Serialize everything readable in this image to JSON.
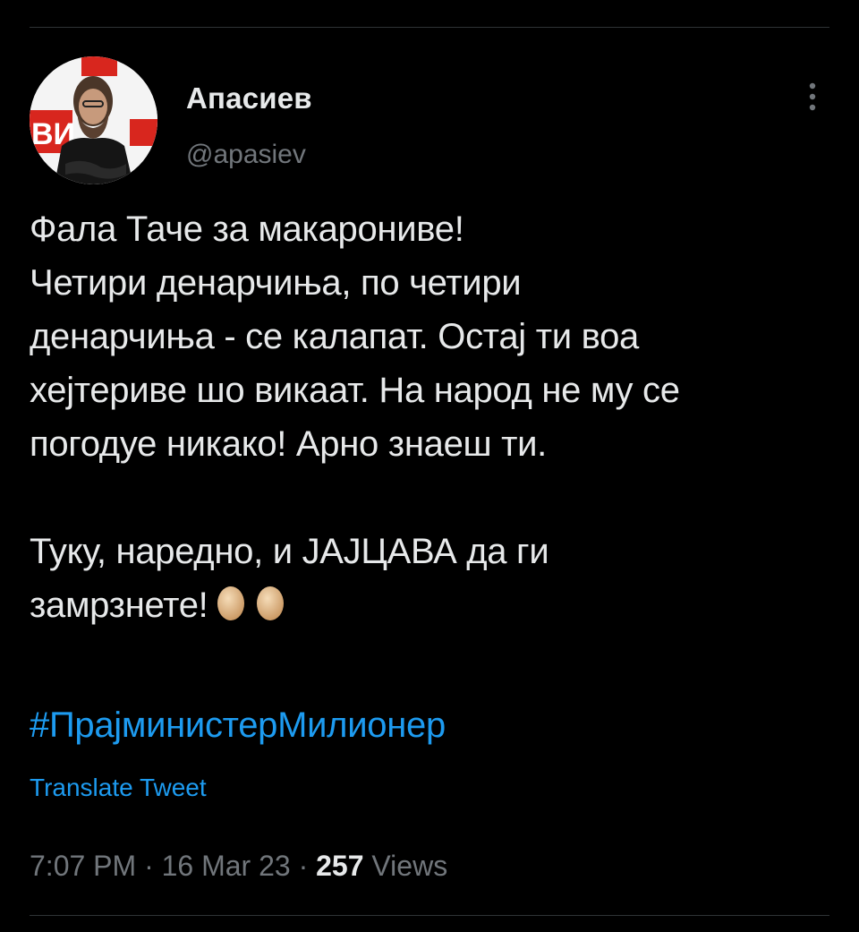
{
  "author": {
    "display_name": "Апасиев",
    "username": "@apasiev",
    "avatar_backdrop_text": "ВИ"
  },
  "tweet": {
    "lines": [
      "Фала Таче за макарониве!",
      "Четири денарчиња, по четири",
      "денарчиња - се калапат. Остај ти воа",
      "хејтериве шо викаат. На народ не му се",
      "погодуе никако! Арно знаеш ти.",
      "",
      "Туку, наредно, и ЈАЈЦАВА да ги",
      "замрзнете!"
    ],
    "hashtag": "#ПрајминистерМилионер",
    "translate_label": "Translate Tweet"
  },
  "meta": {
    "time": "7:07 PM",
    "separator": "·",
    "date": "16 Mar 23",
    "views_count": "257",
    "views_label": "Views"
  },
  "icons": {
    "more": "more-vertical-icon",
    "egg": "egg-emoji-icon"
  },
  "colors": {
    "background": "#000000",
    "text": "#e7e9ea",
    "secondary": "#71767b",
    "accent": "#1d9bf0",
    "divider": "#2f3336"
  }
}
